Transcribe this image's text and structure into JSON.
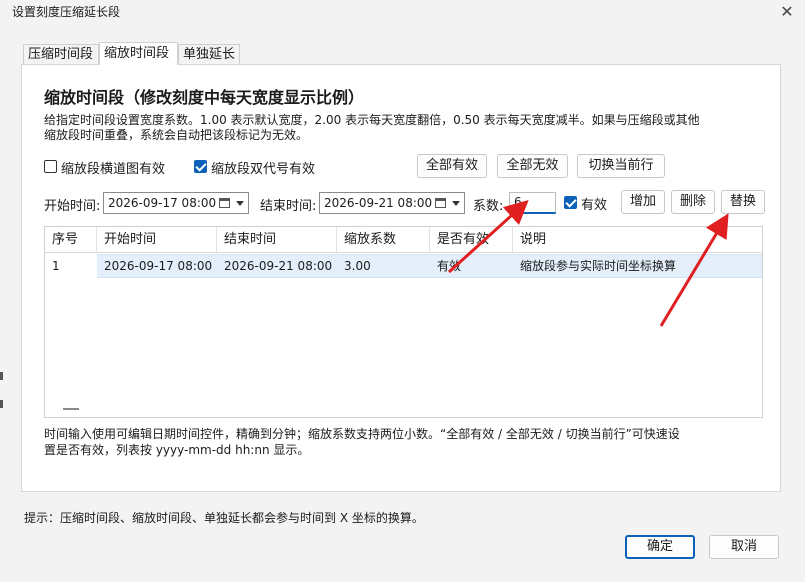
{
  "window": {
    "title": "设置刻度压缩延长段"
  },
  "tabs": [
    {
      "label": "压缩时间段"
    },
    {
      "label": "缩放时间段"
    },
    {
      "label": "单独延长"
    }
  ],
  "panel": {
    "heading": "缩放时间段（修改刻度中每天宽度显示比例）",
    "description_line1": "给指定时间段设置宽度系数。1.00 表示默认宽度，2.00 表示每天宽度翻倍，0.50 表示每天宽度减半。如果与压缩段或其他",
    "description_line2": "缩放段时间重叠，系统会自动把该段标记为无效。",
    "options": {
      "timeline_valid": {
        "label": "缩放段横道图有效",
        "checked": false
      },
      "dual_code_valid": {
        "label": "缩放段双代号有效",
        "checked": true
      }
    },
    "toolbar": {
      "all_valid": "全部有效",
      "all_invalid": "全部无效",
      "toggle_current": "切换当前行"
    },
    "editor": {
      "start_label": "开始时间:",
      "start_value": "2026-09-17 08:00",
      "end_label": "结束时间:",
      "end_value": "2026-09-21 08:00",
      "coef_label": "系数:",
      "coef_value": "6",
      "valid_label": "有效",
      "valid_checked": true,
      "add": "增加",
      "delete": "删除",
      "replace": "替换"
    },
    "table": {
      "columns": [
        "序号",
        "开始时间",
        "结束时间",
        "缩放系数",
        "是否有效",
        "说明"
      ],
      "rows": [
        [
          "1",
          "2026-09-17 08:00",
          "2026-09-21 08:00",
          "3.00",
          "有效",
          "缩放段参与实际时间坐标换算"
        ]
      ]
    },
    "note_line1": "时间输入使用可编辑日期时间控件，精确到分钟；缩放系数支持两位小数。“全部有效 / 全部无效 / 切换当前行”可快速设",
    "note_line2": "置是否有效，列表按 yyyy-mm-dd hh:nn 显示。"
  },
  "tip": "提示：压缩时间段、缩放时间段、单独延长都会参与时间到 X 坐标的换算。",
  "buttons": {
    "ok": "确定",
    "cancel": "取消"
  },
  "colors": {
    "accent": "#0b62b8",
    "annotation_arrow": "#e02020",
    "selected_row": "#e4effb"
  }
}
